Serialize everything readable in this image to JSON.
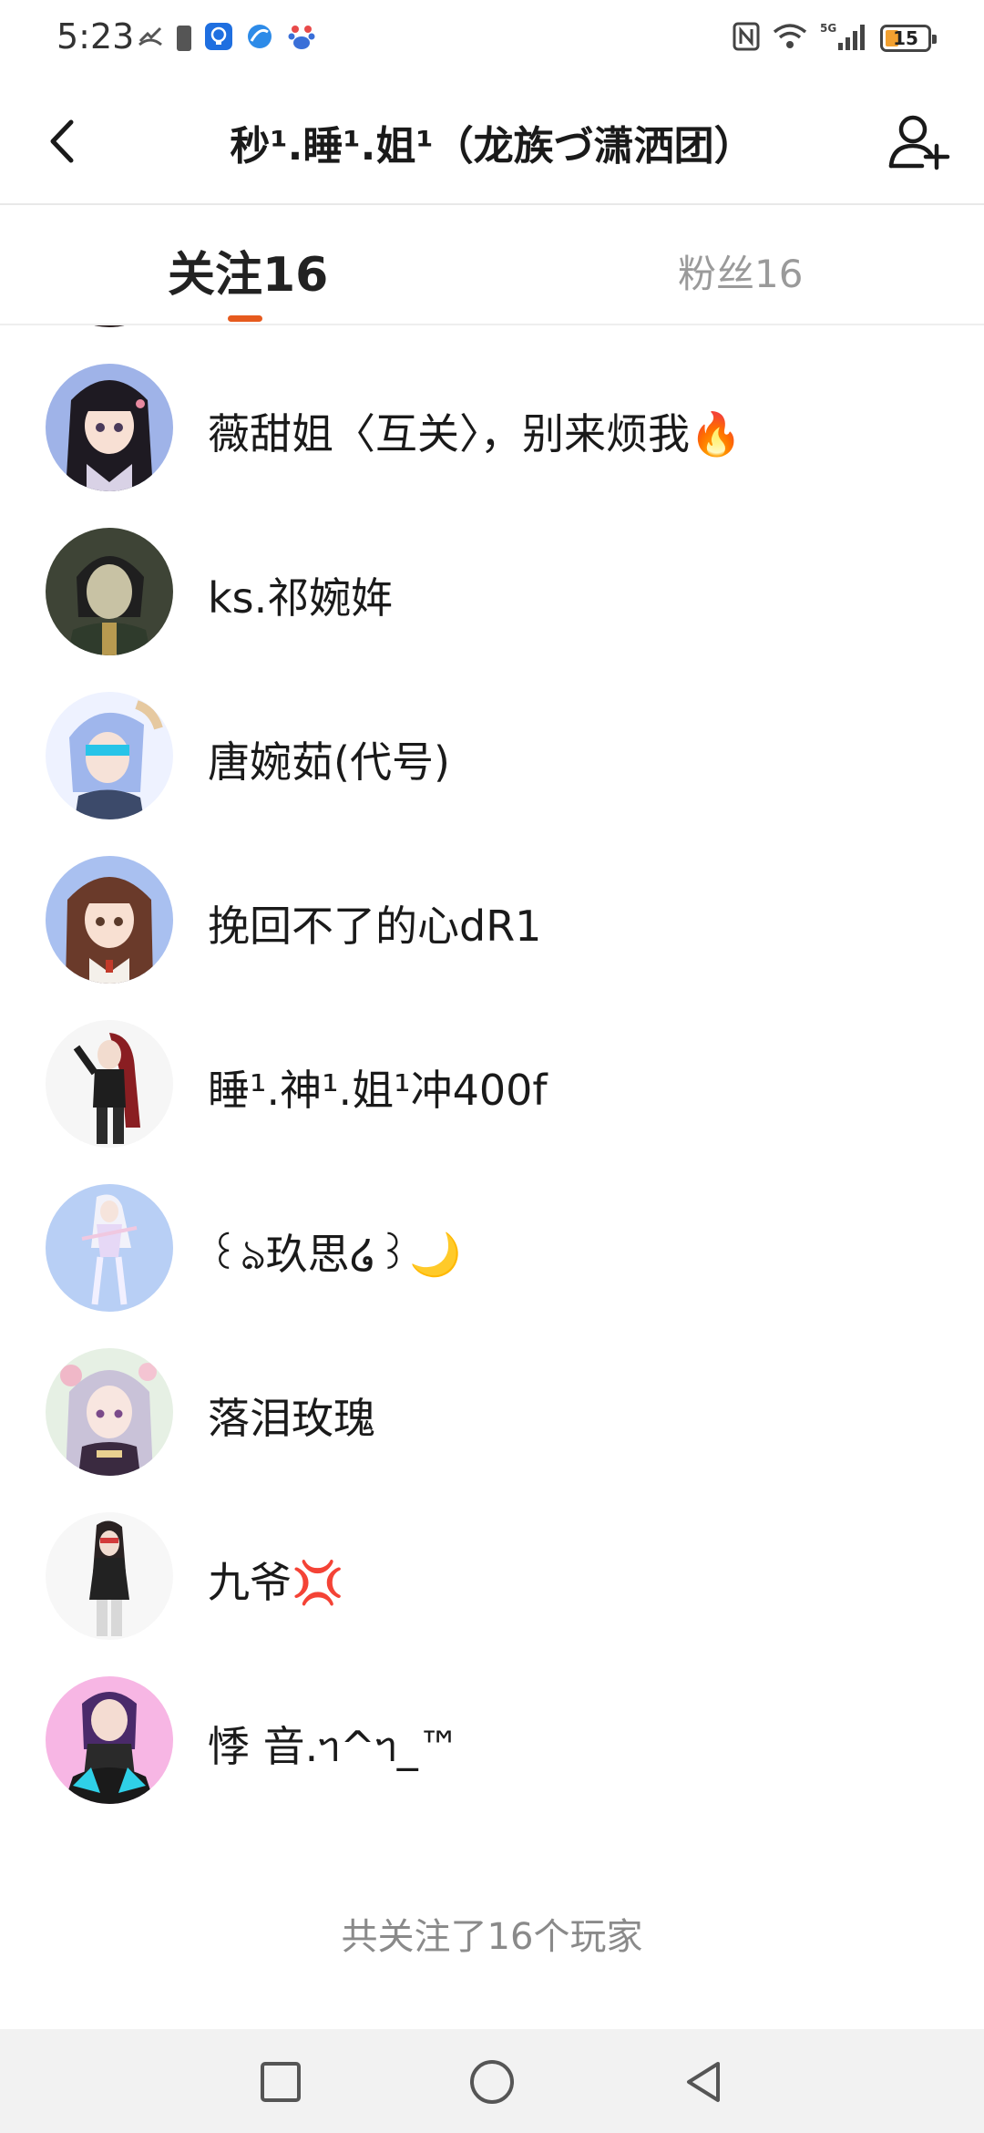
{
  "status_bar": {
    "time": "5:23",
    "battery_level": "15",
    "network": "5G"
  },
  "header": {
    "title": "秒¹.睡¹.姐¹（龙族づ潇洒团）"
  },
  "tabs": [
    {
      "label": "关注16",
      "active": true
    },
    {
      "label": "粉丝16",
      "active": false
    }
  ],
  "following_list": [
    {
      "name": "",
      "avatar_bg": "#cfd6f2"
    },
    {
      "name": "薇甜姐〈互关〉，别来烦我🔥",
      "avatar_bg": "#9fb3e8"
    },
    {
      "name": "ks.祁婉姩",
      "avatar_bg": "#4a5040"
    },
    {
      "name": "唐婉茹(代号)",
      "avatar_bg": "#eef2ff"
    },
    {
      "name": "挽回不了的心dR1",
      "avatar_bg": "#a9c0f0"
    },
    {
      "name": "睡¹.神¹.姐¹冲400f",
      "avatar_bg": "#f6f6f6"
    },
    {
      "name": "꒰ঌ玖思໒꒱🌙",
      "avatar_bg": "#b8cff5"
    },
    {
      "name": "落泪玫瑰",
      "avatar_bg": "#e6f0e4"
    },
    {
      "name": "九爷💢",
      "avatar_bg": "#f7f7f7"
    },
    {
      "name": "悸  音.ᥐ^ᥐ_™",
      "avatar_bg": "#f7b6e4"
    }
  ],
  "summary": "共关注了16个玩家",
  "colors": {
    "accent": "#e65a1e",
    "inactive_tab": "#9a9a9a"
  }
}
